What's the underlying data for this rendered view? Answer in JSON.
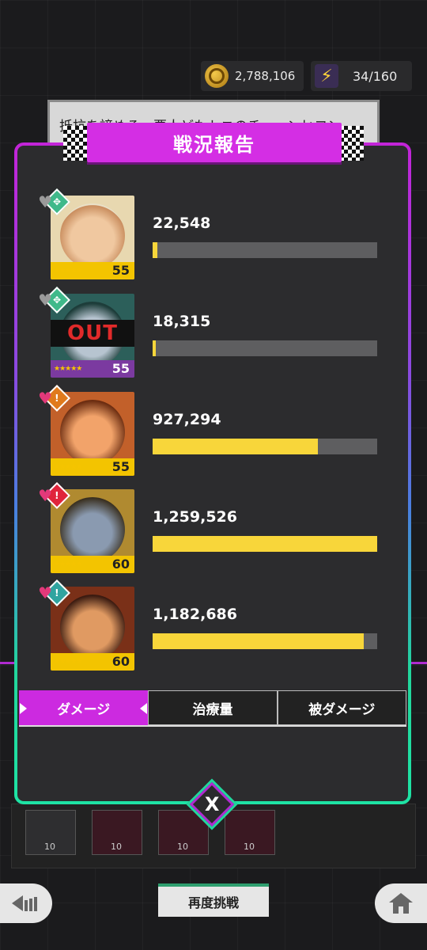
{
  "resources": {
    "coins": "2,788,106",
    "energy": "34/160",
    "coin_icon": "gold-coin-icon",
    "energy_icon": "lightning-icon"
  },
  "background_text": "抵抗を諦める、悪人どもトニのチェーンヒコン",
  "panel": {
    "title": "戦況報告",
    "accent": "#d42ee4",
    "bar_color": "#f8d63a"
  },
  "party": [
    {
      "damage": "22,548",
      "level": "55",
      "role": "support",
      "role_symbol": "✥",
      "status": "",
      "fill_ratio": 0.02,
      "role_color": "#3fb98a"
    },
    {
      "damage": "18,315",
      "level": "55",
      "role": "support",
      "role_symbol": "✥",
      "status": "OUT",
      "fill_ratio": 0.015,
      "role_color": "#3fb98a"
    },
    {
      "damage": "927,294",
      "level": "55",
      "role": "attacker",
      "role_symbol": "!",
      "status": "",
      "fill_ratio": 0.736,
      "role_color": "#e07a1c"
    },
    {
      "damage": "1,259,526",
      "level": "60",
      "role": "attacker",
      "role_symbol": "!",
      "status": "",
      "fill_ratio": 1.0,
      "role_color": "#e0243c"
    },
    {
      "damage": "1,182,686",
      "level": "60",
      "role": "tank",
      "role_symbol": "!",
      "status": "",
      "fill_ratio": 0.94,
      "role_color": "#2fa4a0"
    }
  ],
  "tabs": [
    {
      "label": "ダメージ",
      "active": true
    },
    {
      "label": "治療量",
      "active": false
    },
    {
      "label": "被ダメージ",
      "active": false
    }
  ],
  "close_label": "X",
  "items": [
    "10",
    "10",
    "10",
    "10"
  ],
  "retry_label": "再度挑戦"
}
